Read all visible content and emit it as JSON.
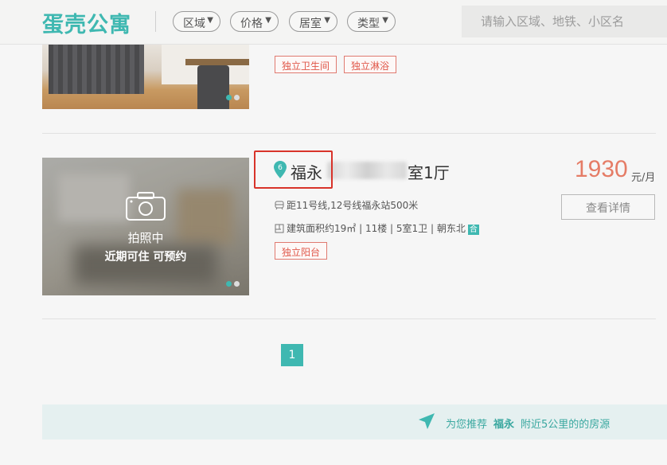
{
  "header": {
    "logo": "蛋壳公寓",
    "filters": [
      "区域",
      "价格",
      "居室",
      "类型"
    ],
    "search_placeholder": "请输入区域、地铁、小区名"
  },
  "listing1": {
    "tags": [
      "独立卫生间",
      "独立淋浴"
    ]
  },
  "listing2": {
    "photo_status": "拍照中",
    "photo_note": "近期可住 可预约",
    "pin_number": "6",
    "location": "福永",
    "room_type": "室1厅",
    "price": "1930",
    "price_unit": "元/月",
    "detail_button": "查看详情",
    "subway": "距11号线,12号线福永站500米",
    "specs": "建筑面积约19㎡ | 11楼 | 5室1卫 | 朝东北",
    "orientation_badge": "合",
    "tags": [
      "独立阳台"
    ]
  },
  "pagination": {
    "current": "1"
  },
  "recommend": {
    "prefix": "为您推荐",
    "place": "福永",
    "suffix": "附近5公里的的房源"
  },
  "colors": {
    "brand": "#3fb8b1",
    "price": "#e57c66",
    "tag": "#e0584a",
    "highlight": "#d8332a"
  }
}
